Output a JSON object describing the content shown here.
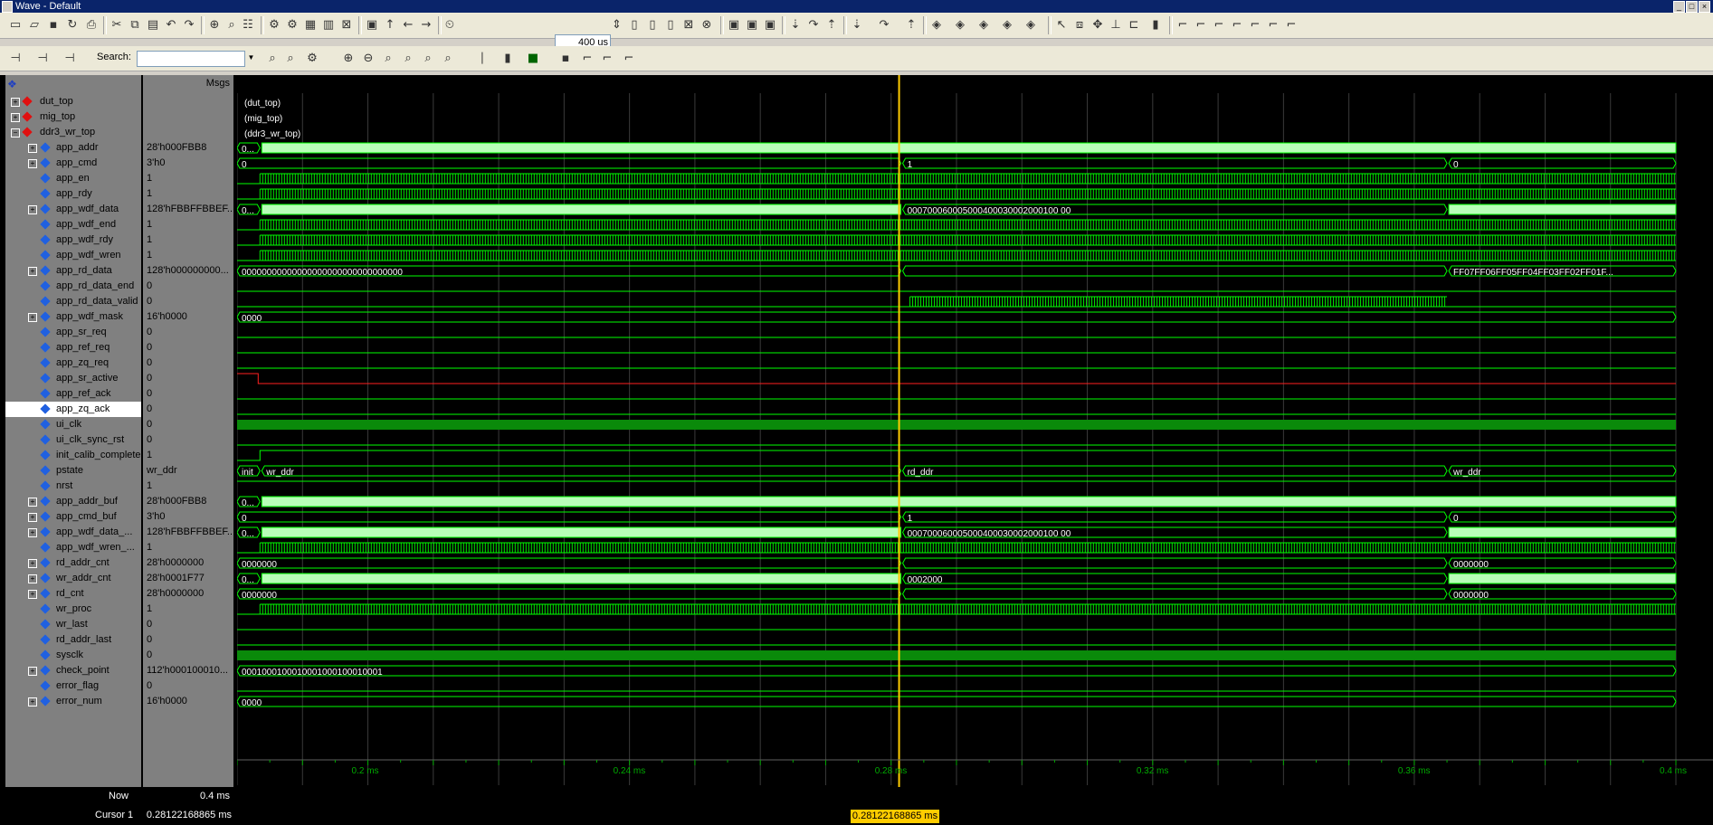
{
  "window": {
    "title": "Wave - Default"
  },
  "toolbar": {
    "zoom_value": "400 us"
  },
  "search": {
    "label": "Search:",
    "value": ""
  },
  "header": {
    "msgs_label": "Msgs"
  },
  "signals": [
    {
      "name": "dut_top",
      "value": "",
      "level": 0,
      "expandable": true,
      "icon": "red-diamond",
      "selected": false
    },
    {
      "name": "mig_top",
      "value": "",
      "level": 0,
      "expandable": true,
      "icon": "red-diamond",
      "selected": false
    },
    {
      "name": "ddr3_wr_top",
      "value": "",
      "level": 0,
      "expandable": true,
      "icon": "red-diamond",
      "selected": false
    },
    {
      "name": "app_addr",
      "value": "28'h000FBB8",
      "level": 1,
      "expandable": true,
      "icon": "blue-diamond",
      "selected": false
    },
    {
      "name": "app_cmd",
      "value": "3'h0",
      "level": 1,
      "expandable": true,
      "icon": "blue-diamond",
      "selected": false
    },
    {
      "name": "app_en",
      "value": "1",
      "level": 1,
      "expandable": false,
      "icon": "blue-diamond",
      "selected": false
    },
    {
      "name": "app_rdy",
      "value": "1",
      "level": 1,
      "expandable": false,
      "icon": "blue-diamond",
      "selected": false
    },
    {
      "name": "app_wdf_data",
      "value": "128'hFBBFFBBEF...",
      "level": 1,
      "expandable": true,
      "icon": "blue-diamond",
      "selected": false
    },
    {
      "name": "app_wdf_end",
      "value": "1",
      "level": 1,
      "expandable": false,
      "icon": "blue-diamond",
      "selected": false
    },
    {
      "name": "app_wdf_rdy",
      "value": "1",
      "level": 1,
      "expandable": false,
      "icon": "blue-diamond",
      "selected": false
    },
    {
      "name": "app_wdf_wren",
      "value": "1",
      "level": 1,
      "expandable": false,
      "icon": "blue-diamond",
      "selected": false
    },
    {
      "name": "app_rd_data",
      "value": "128'h000000000...",
      "level": 1,
      "expandable": true,
      "icon": "blue-diamond",
      "selected": false
    },
    {
      "name": "app_rd_data_end",
      "value": "0",
      "level": 1,
      "expandable": false,
      "icon": "blue-diamond",
      "selected": false
    },
    {
      "name": "app_rd_data_valid",
      "value": "0",
      "level": 1,
      "expandable": false,
      "icon": "blue-diamond",
      "selected": false
    },
    {
      "name": "app_wdf_mask",
      "value": "16'h0000",
      "level": 1,
      "expandable": true,
      "icon": "blue-diamond",
      "selected": false
    },
    {
      "name": "app_sr_req",
      "value": "0",
      "level": 1,
      "expandable": false,
      "icon": "blue-diamond",
      "selected": false
    },
    {
      "name": "app_ref_req",
      "value": "0",
      "level": 1,
      "expandable": false,
      "icon": "blue-diamond",
      "selected": false
    },
    {
      "name": "app_zq_req",
      "value": "0",
      "level": 1,
      "expandable": false,
      "icon": "blue-diamond",
      "selected": false
    },
    {
      "name": "app_sr_active",
      "value": "0",
      "level": 1,
      "expandable": false,
      "icon": "blue-diamond",
      "selected": false
    },
    {
      "name": "app_ref_ack",
      "value": "0",
      "level": 1,
      "expandable": false,
      "icon": "blue-diamond",
      "selected": false
    },
    {
      "name": "app_zq_ack",
      "value": "0",
      "level": 1,
      "expandable": false,
      "icon": "blue-diamond",
      "selected": true
    },
    {
      "name": "ui_clk",
      "value": "0",
      "level": 1,
      "expandable": false,
      "icon": "blue-diamond",
      "selected": false
    },
    {
      "name": "ui_clk_sync_rst",
      "value": "0",
      "level": 1,
      "expandable": false,
      "icon": "blue-diamond",
      "selected": false
    },
    {
      "name": "init_calib_complete",
      "value": "1",
      "level": 1,
      "expandable": false,
      "icon": "blue-diamond",
      "selected": false
    },
    {
      "name": "pstate",
      "value": "wr_ddr",
      "level": 1,
      "expandable": false,
      "icon": "blue-diamond",
      "selected": false
    },
    {
      "name": "nrst",
      "value": "1",
      "level": 1,
      "expandable": false,
      "icon": "blue-diamond",
      "selected": false
    },
    {
      "name": "app_addr_buf",
      "value": "28'h000FBB8",
      "level": 1,
      "expandable": true,
      "icon": "blue-diamond",
      "selected": false
    },
    {
      "name": "app_cmd_buf",
      "value": "3'h0",
      "level": 1,
      "expandable": true,
      "icon": "blue-diamond",
      "selected": false
    },
    {
      "name": "app_wdf_data_...",
      "value": "128'hFBBFFBBEF...",
      "level": 1,
      "expandable": true,
      "icon": "blue-diamond",
      "selected": false
    },
    {
      "name": "app_wdf_wren_...",
      "value": "1",
      "level": 1,
      "expandable": false,
      "icon": "blue-diamond",
      "selected": false
    },
    {
      "name": "rd_addr_cnt",
      "value": "28'h0000000",
      "level": 1,
      "expandable": true,
      "icon": "blue-diamond",
      "selected": false
    },
    {
      "name": "wr_addr_cnt",
      "value": "28'h0001F77",
      "level": 1,
      "expandable": true,
      "icon": "blue-diamond",
      "selected": false
    },
    {
      "name": "rd_cnt",
      "value": "28'h0000000",
      "level": 1,
      "expandable": true,
      "icon": "blue-diamond",
      "selected": false
    },
    {
      "name": "wr_proc",
      "value": "1",
      "level": 1,
      "expandable": false,
      "icon": "blue-diamond",
      "selected": false
    },
    {
      "name": "wr_last",
      "value": "0",
      "level": 1,
      "expandable": false,
      "icon": "blue-diamond",
      "selected": false
    },
    {
      "name": "rd_addr_last",
      "value": "0",
      "level": 1,
      "expandable": false,
      "icon": "blue-diamond",
      "selected": false
    },
    {
      "name": "sysclk",
      "value": "0",
      "level": 1,
      "expandable": false,
      "icon": "blue-diamond",
      "selected": false
    },
    {
      "name": "check_point",
      "value": "112'h000100010...",
      "level": 1,
      "expandable": true,
      "icon": "blue-diamond",
      "selected": false
    },
    {
      "name": "error_flag",
      "value": "0",
      "level": 1,
      "expandable": false,
      "icon": "blue-diamond",
      "selected": false
    },
    {
      "name": "error_num",
      "value": "16'h0000",
      "level": 1,
      "expandable": true,
      "icon": "blue-diamond",
      "selected": false
    }
  ],
  "waves": [
    {
      "kind": "label",
      "text": "(dut_top)"
    },
    {
      "kind": "label",
      "text": "(mig_top)"
    },
    {
      "kind": "label",
      "text": "(ddr3_wr_top)"
    },
    {
      "kind": "bus",
      "segments": [
        "0...",
        ""
      ],
      "dense": true
    },
    {
      "kind": "bus",
      "segments": [
        "0",
        "1",
        "0"
      ],
      "dense": false
    },
    {
      "kind": "dense"
    },
    {
      "kind": "dense"
    },
    {
      "kind": "bus",
      "segments": [
        "0...",
        "",
        "000700060005000400030002000100 00",
        ""
      ],
      "dense": true
    },
    {
      "kind": "dense"
    },
    {
      "kind": "dense"
    },
    {
      "kind": "dense"
    },
    {
      "kind": "bus",
      "segments": [
        "00000000000000000000000000000000",
        "",
        "FF07FF06FF05FF04FF03FF02FF01F..."
      ],
      "dense": false
    },
    {
      "kind": "low"
    },
    {
      "kind": "dense_rd"
    },
    {
      "kind": "bus",
      "segments": [
        "0000"
      ],
      "dense": false
    },
    {
      "kind": "low"
    },
    {
      "kind": "low"
    },
    {
      "kind": "low"
    },
    {
      "kind": "glitch_red"
    },
    {
      "kind": "low"
    },
    {
      "kind": "low"
    },
    {
      "kind": "solid"
    },
    {
      "kind": "low"
    },
    {
      "kind": "high_after"
    },
    {
      "kind": "bus",
      "segments": [
        "init",
        "wr_ddr",
        "rd_ddr",
        "wr_ddr"
      ],
      "dense": false
    },
    {
      "kind": "high"
    },
    {
      "kind": "bus",
      "segments": [
        "0...",
        ""
      ],
      "dense": true
    },
    {
      "kind": "bus",
      "segments": [
        "0",
        "1",
        "0"
      ],
      "dense": false
    },
    {
      "kind": "bus",
      "segments": [
        "0...",
        "",
        "000700060005000400030002000100 00",
        ""
      ],
      "dense": true
    },
    {
      "kind": "dense"
    },
    {
      "kind": "bus",
      "segments": [
        "0000000",
        "",
        "0000000"
      ],
      "dense": false
    },
    {
      "kind": "bus",
      "segments": [
        "0...",
        "",
        "0002000",
        ""
      ],
      "dense": true
    },
    {
      "kind": "bus",
      "segments": [
        "0000000",
        "",
        "0000000"
      ],
      "dense": false
    },
    {
      "kind": "dense"
    },
    {
      "kind": "low"
    },
    {
      "kind": "low"
    },
    {
      "kind": "solid"
    },
    {
      "kind": "bus",
      "segments": [
        "0001000100010001000100010001"
      ],
      "dense": false
    },
    {
      "kind": "low"
    },
    {
      "kind": "bus",
      "segments": [
        "0000"
      ],
      "dense": false
    }
  ],
  "timeline": {
    "start_ms": 0.18,
    "end_ms": 0.4,
    "ticks": [
      {
        "ms": 0.2,
        "label": "0.2 ms"
      },
      {
        "ms": 0.24,
        "label": "0.24 ms"
      },
      {
        "ms": 0.28,
        "label": "0.28 ms"
      },
      {
        "ms": 0.32,
        "label": "0.32 ms"
      },
      {
        "ms": 0.36,
        "label": "0.36 ms"
      },
      {
        "ms": 0.4,
        "label": "0.4 ms"
      }
    ],
    "cursor_ms": 0.28122168865,
    "rd_start_ms": 0.2815,
    "rd_end_ms": 0.365
  },
  "status": {
    "now_label": "Now",
    "now_value": "0.4 ms",
    "cursor_label": "Cursor 1",
    "cursor_value": "0.28122168865 ms",
    "cursor_box": "0.28122168865 ms"
  },
  "colors": {
    "wave": "#00ff00",
    "bus_fill": "#b8ffb8",
    "cursor": "#ffcc00",
    "grid": "#505050"
  }
}
